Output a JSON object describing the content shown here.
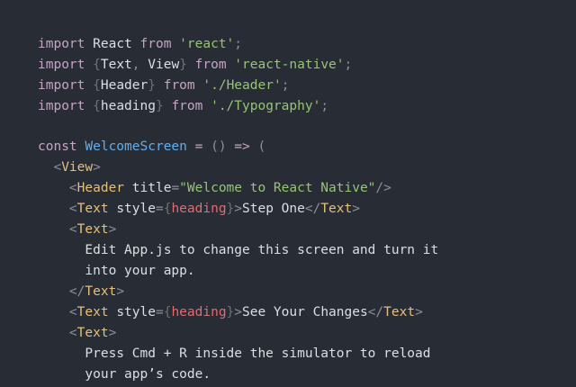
{
  "theme": {
    "background": "#282c34",
    "keyword": "#c5a5c5",
    "string": "#98c379",
    "function": "#61afef",
    "tag": "#e5c07b",
    "attribute": "#d19a66",
    "variable": "#e06c75",
    "text": "#dcdfe4"
  },
  "code": {
    "lines": [
      [
        {
          "t": "import",
          "k": "kw"
        },
        {
          "t": " ",
          "k": "text"
        },
        {
          "t": "React",
          "k": "id"
        },
        {
          "t": " ",
          "k": "text"
        },
        {
          "t": "from",
          "k": "kw"
        },
        {
          "t": " ",
          "k": "text"
        },
        {
          "t": "'react'",
          "k": "str"
        },
        {
          "t": ";",
          "k": "punct"
        }
      ],
      [
        {
          "t": "import",
          "k": "kw"
        },
        {
          "t": " ",
          "k": "text"
        },
        {
          "t": "{",
          "k": "brace"
        },
        {
          "t": "Text",
          "k": "id"
        },
        {
          "t": ", ",
          "k": "punct"
        },
        {
          "t": "View",
          "k": "id"
        },
        {
          "t": "}",
          "k": "brace"
        },
        {
          "t": " ",
          "k": "text"
        },
        {
          "t": "from",
          "k": "kw"
        },
        {
          "t": " ",
          "k": "text"
        },
        {
          "t": "'react-native'",
          "k": "str"
        },
        {
          "t": ";",
          "k": "punct"
        }
      ],
      [
        {
          "t": "import",
          "k": "kw"
        },
        {
          "t": " ",
          "k": "text"
        },
        {
          "t": "{",
          "k": "brace"
        },
        {
          "t": "Header",
          "k": "id"
        },
        {
          "t": "}",
          "k": "brace"
        },
        {
          "t": " ",
          "k": "text"
        },
        {
          "t": "from",
          "k": "kw"
        },
        {
          "t": " ",
          "k": "text"
        },
        {
          "t": "'./Header'",
          "k": "str"
        },
        {
          "t": ";",
          "k": "punct"
        }
      ],
      [
        {
          "t": "import",
          "k": "kw"
        },
        {
          "t": " ",
          "k": "text"
        },
        {
          "t": "{",
          "k": "brace"
        },
        {
          "t": "heading",
          "k": "id"
        },
        {
          "t": "}",
          "k": "brace"
        },
        {
          "t": " ",
          "k": "text"
        },
        {
          "t": "from",
          "k": "kw"
        },
        {
          "t": " ",
          "k": "text"
        },
        {
          "t": "'./Typography'",
          "k": "str"
        },
        {
          "t": ";",
          "k": "punct"
        }
      ],
      [],
      [
        {
          "t": "const",
          "k": "kw"
        },
        {
          "t": " ",
          "k": "text"
        },
        {
          "t": "WelcomeScreen",
          "k": "fn"
        },
        {
          "t": " ",
          "k": "text"
        },
        {
          "t": "=",
          "k": "op"
        },
        {
          "t": " ",
          "k": "text"
        },
        {
          "t": "()",
          "k": "punct"
        },
        {
          "t": " ",
          "k": "text"
        },
        {
          "t": "=>",
          "k": "op"
        },
        {
          "t": " ",
          "k": "text"
        },
        {
          "t": "(",
          "k": "punct"
        }
      ],
      [
        {
          "t": "  ",
          "k": "text"
        },
        {
          "t": "<",
          "k": "punct"
        },
        {
          "t": "View",
          "k": "tag"
        },
        {
          "t": ">",
          "k": "punct"
        }
      ],
      [
        {
          "t": "    ",
          "k": "text"
        },
        {
          "t": "<",
          "k": "punct"
        },
        {
          "t": "Header",
          "k": "tag"
        },
        {
          "t": " ",
          "k": "text"
        },
        {
          "t": "title",
          "k": "id"
        },
        {
          "t": "=",
          "k": "punct"
        },
        {
          "t": "\"Welcome to React Native\"",
          "k": "str"
        },
        {
          "t": "/>",
          "k": "punct"
        }
      ],
      [
        {
          "t": "    ",
          "k": "text"
        },
        {
          "t": "<",
          "k": "punct"
        },
        {
          "t": "Text",
          "k": "tag"
        },
        {
          "t": " ",
          "k": "text"
        },
        {
          "t": "style",
          "k": "id"
        },
        {
          "t": "=",
          "k": "punct"
        },
        {
          "t": "{",
          "k": "brace"
        },
        {
          "t": "heading",
          "k": "var"
        },
        {
          "t": "}",
          "k": "brace"
        },
        {
          "t": ">",
          "k": "punct"
        },
        {
          "t": "Step One",
          "k": "text"
        },
        {
          "t": "</",
          "k": "punct"
        },
        {
          "t": "Text",
          "k": "tag"
        },
        {
          "t": ">",
          "k": "punct"
        }
      ],
      [
        {
          "t": "    ",
          "k": "text"
        },
        {
          "t": "<",
          "k": "punct"
        },
        {
          "t": "Text",
          "k": "tag"
        },
        {
          "t": ">",
          "k": "punct"
        }
      ],
      [
        {
          "t": "      ",
          "k": "text"
        },
        {
          "t": "Edit App.js to change this screen and turn it",
          "k": "text"
        }
      ],
      [
        {
          "t": "      ",
          "k": "text"
        },
        {
          "t": "into your app.",
          "k": "text"
        }
      ],
      [
        {
          "t": "    ",
          "k": "text"
        },
        {
          "t": "</",
          "k": "punct"
        },
        {
          "t": "Text",
          "k": "tag"
        },
        {
          "t": ">",
          "k": "punct"
        }
      ],
      [
        {
          "t": "    ",
          "k": "text"
        },
        {
          "t": "<",
          "k": "punct"
        },
        {
          "t": "Text",
          "k": "tag"
        },
        {
          "t": " ",
          "k": "text"
        },
        {
          "t": "style",
          "k": "id"
        },
        {
          "t": "=",
          "k": "punct"
        },
        {
          "t": "{",
          "k": "brace"
        },
        {
          "t": "heading",
          "k": "var"
        },
        {
          "t": "}",
          "k": "brace"
        },
        {
          "t": ">",
          "k": "punct"
        },
        {
          "t": "See Your Changes",
          "k": "text"
        },
        {
          "t": "</",
          "k": "punct"
        },
        {
          "t": "Text",
          "k": "tag"
        },
        {
          "t": ">",
          "k": "punct"
        }
      ],
      [
        {
          "t": "    ",
          "k": "text"
        },
        {
          "t": "<",
          "k": "punct"
        },
        {
          "t": "Text",
          "k": "tag"
        },
        {
          "t": ">",
          "k": "punct"
        }
      ],
      [
        {
          "t": "      ",
          "k": "text"
        },
        {
          "t": "Press Cmd + R inside the simulator to reload",
          "k": "text"
        }
      ],
      [
        {
          "t": "      ",
          "k": "text"
        },
        {
          "t": "your app’s code.",
          "k": "text"
        }
      ]
    ]
  }
}
